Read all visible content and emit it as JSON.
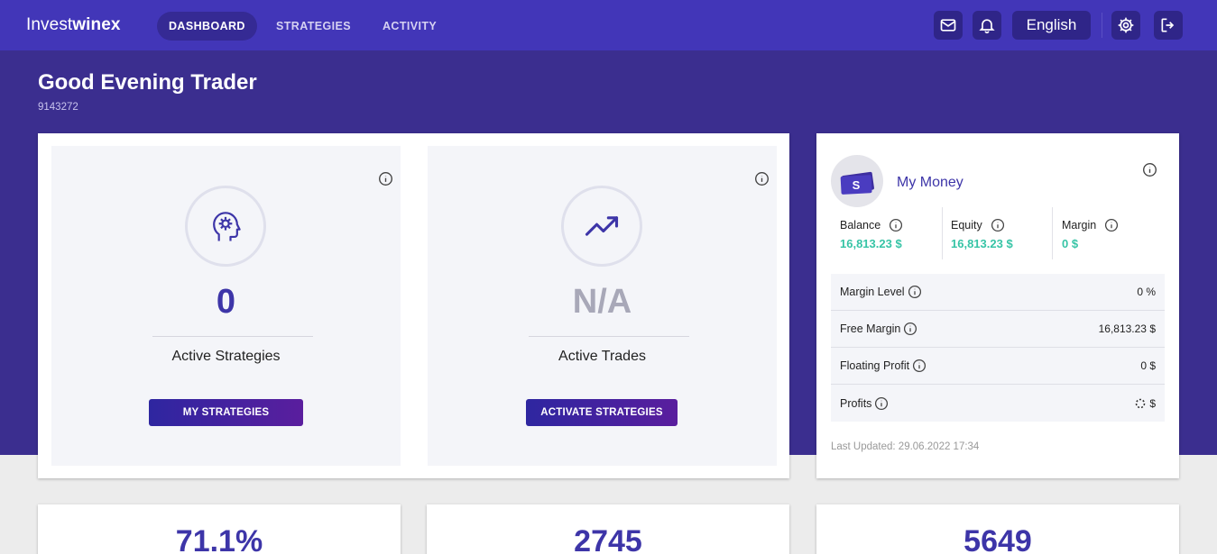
{
  "navbar": {
    "brand_part1": "Invest",
    "brand_part2": "winex",
    "tabs": [
      {
        "label": "DASHBOARD",
        "active": true
      },
      {
        "label": "STRATEGIES",
        "active": false
      },
      {
        "label": "ACTIVITY",
        "active": false
      }
    ],
    "language": "English",
    "icons": [
      "mail-icon",
      "bell-icon",
      "gear-icon",
      "logout-icon"
    ]
  },
  "hero": {
    "greeting": "Good Evening Trader",
    "account_id": "9143272"
  },
  "stats": {
    "strategies": {
      "value": "0",
      "label": "Active Strategies",
      "button": "MY STRATEGIES",
      "icon": "head-gear-icon"
    },
    "trades": {
      "value": "N/A",
      "label": "Active Trades",
      "button": "ACTIVATE STRATEGIES",
      "icon": "trend-up-icon"
    }
  },
  "money": {
    "title": "My Money",
    "balance": {
      "label": "Balance",
      "value": "16,813.23 $"
    },
    "equity": {
      "label": "Equity",
      "value": "16,813.23 $"
    },
    "margin": {
      "label": "Margin",
      "value": "0 $"
    },
    "rows": [
      {
        "label": "Margin Level",
        "value": "0 %"
      },
      {
        "label": "Free Margin",
        "value": "16,813.23 $"
      },
      {
        "label": "Floating Profit",
        "value": "0 $"
      },
      {
        "label": "Profits",
        "value": "$"
      }
    ],
    "last_updated": "Last Updated: 29.06.2022 17:34"
  },
  "bottom": {
    "values": [
      "71.1%",
      "2745",
      "5649"
    ]
  },
  "colors": {
    "nav_bg": "#4236b8",
    "hero_bg": "#3b2e8f",
    "accent": "#3d35a8",
    "green": "#37c4a6"
  }
}
